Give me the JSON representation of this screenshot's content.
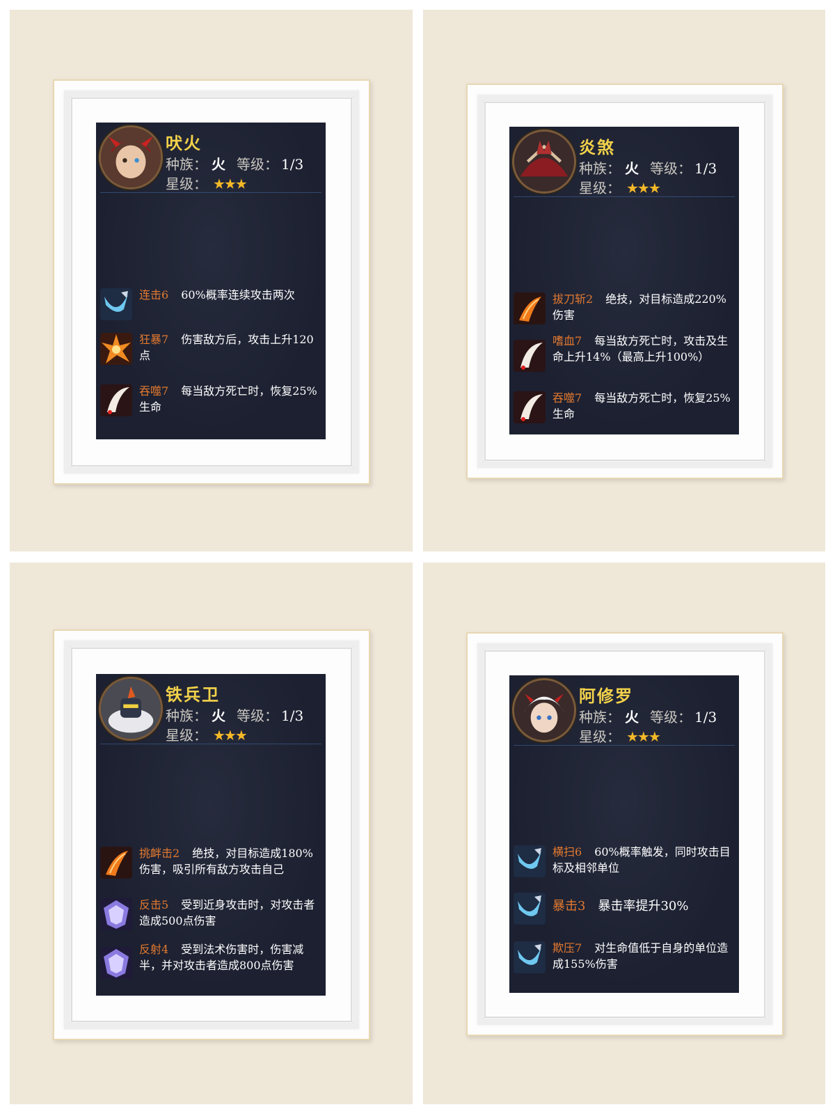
{
  "labels": {
    "race": "种族：",
    "level": "等级：",
    "star": "星级："
  },
  "cards": [
    {
      "name": "吠火",
      "race": "火",
      "level": "1/3",
      "stars": "★★★",
      "skills": [
        {
          "name": "连击6",
          "desc": "60%概率连续攻击两次",
          "icon": "blade-icon"
        },
        {
          "name": "狂暴7",
          "desc": "伤害敌方后，攻击上升120点",
          "icon": "burst-icon"
        },
        {
          "name": "吞噬7",
          "desc": "每当敌方死亡时，恢复25%生命",
          "icon": "fang-icon"
        }
      ]
    },
    {
      "name": "炎煞",
      "race": "火",
      "level": "1/3",
      "stars": "★★★",
      "skills": [
        {
          "name": "拔刀斩2",
          "desc": "绝技，对目标造成220%伤害",
          "icon": "flame-slash-icon"
        },
        {
          "name": "嗜血7",
          "desc": "每当敌方死亡时，攻击及生命上升14%（最高上升100%）",
          "icon": "fang-icon"
        },
        {
          "name": "吞噬7",
          "desc": "每当敌方死亡时，恢复25%生命",
          "icon": "fang-icon"
        }
      ]
    },
    {
      "name": "铁兵卫",
      "race": "火",
      "level": "1/3",
      "stars": "★★★",
      "skills": [
        {
          "name": "挑衅击2",
          "desc": "绝技，对目标造成180%伤害，吸引所有敌方攻击自己",
          "icon": "flame-slash-icon"
        },
        {
          "name": "反击5",
          "desc": "受到近身攻击时，对攻击者造成500点伤害",
          "icon": "shield-icon"
        },
        {
          "name": "反射4",
          "desc": "受到法术伤害时，伤害减半，并对攻击者造成800点伤害",
          "icon": "shield-icon"
        }
      ]
    },
    {
      "name": "阿修罗",
      "race": "火",
      "level": "1/3",
      "stars": "★★★",
      "skills": [
        {
          "name": "横扫6",
          "desc": "60%概率触发，同时攻击目标及相邻单位",
          "icon": "blade-icon"
        },
        {
          "name": "暴击3",
          "desc": "暴击率提升30%",
          "icon": "blade-icon"
        },
        {
          "name": "欺压7",
          "desc": "对生命值低于自身的单位造成155%伤害",
          "icon": "blade-icon"
        }
      ]
    }
  ],
  "colors": {
    "name": "#f3d24a",
    "skill_name": "#e3792f",
    "card_bg": "#1f2333",
    "backdrop": "#efe7d8"
  }
}
